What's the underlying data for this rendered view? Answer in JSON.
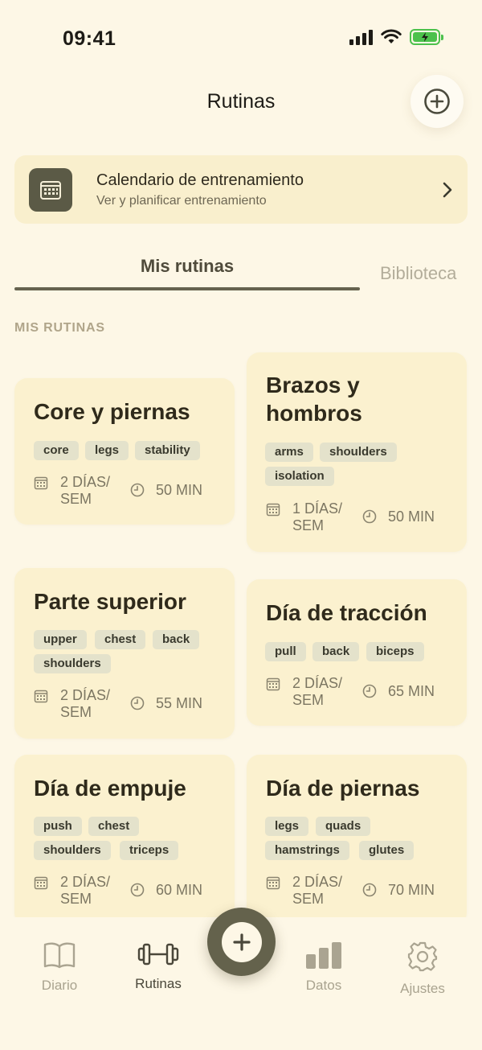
{
  "status_bar": {
    "time": "09:41"
  },
  "header": {
    "title": "Rutinas"
  },
  "calendar_card": {
    "title": "Calendario de entrenamiento",
    "subtitle": "Ver y planificar entrenamiento"
  },
  "tabs": [
    {
      "label": "Mis rutinas",
      "active": true
    },
    {
      "label": "Biblioteca",
      "active": false
    }
  ],
  "section_label": "MIS RUTINAS",
  "routines": [
    {
      "title": "Core y piernas",
      "tags": [
        "core",
        "legs",
        "stability"
      ],
      "days": "2 DÍAS/ SEM",
      "duration": "50 MIN"
    },
    {
      "title": "Brazos y hombros",
      "tags": [
        "arms",
        "shoulders",
        "isolation"
      ],
      "days": "1 DÍAS/ SEM",
      "duration": "50 MIN"
    },
    {
      "title": "Parte superior",
      "tags": [
        "upper",
        "chest",
        "back",
        "shoulders"
      ],
      "days": "2 DÍAS/ SEM",
      "duration": "55 MIN"
    },
    {
      "title": "Día de tracción",
      "tags": [
        "pull",
        "back",
        "biceps"
      ],
      "days": "2 DÍAS/ SEM",
      "duration": "65 MIN"
    },
    {
      "title": "Día de empuje",
      "tags": [
        "push",
        "chest",
        "shoulders",
        "triceps"
      ],
      "days": "2 DÍAS/ SEM",
      "duration": "60 MIN"
    },
    {
      "title": "Día de piernas",
      "tags": [
        "legs",
        "quads",
        "hamstrings",
        "glutes"
      ],
      "days": "2 DÍAS/ SEM",
      "duration": "70 MIN"
    }
  ],
  "bottom_nav": [
    {
      "label": "Diario",
      "icon": "book-icon",
      "active": false
    },
    {
      "label": "Rutinas",
      "icon": "dumbbell-icon",
      "active": true
    },
    {
      "label": "Datos",
      "icon": "bar-chart-icon",
      "active": false
    },
    {
      "label": "Ajustes",
      "icon": "gear-icon",
      "active": false
    }
  ],
  "colors": {
    "background": "#fdf7e6",
    "card": "#fbf1cf",
    "accent": "#64624c",
    "battery": "#4cc14c"
  }
}
